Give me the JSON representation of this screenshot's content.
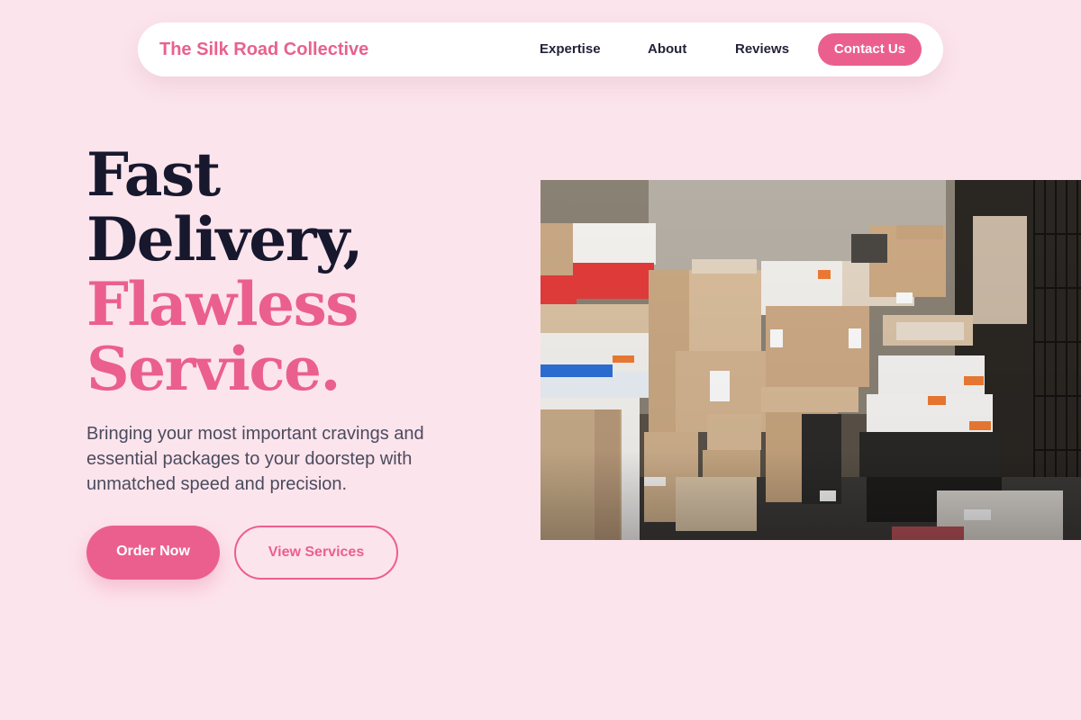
{
  "nav": {
    "brand": "The Silk Road Collective",
    "links": [
      {
        "label": "Expertise"
      },
      {
        "label": "About"
      },
      {
        "label": "Reviews"
      }
    ],
    "cta": "Contact Us"
  },
  "hero": {
    "headline": {
      "line1": "Fast",
      "line2": "Delivery,",
      "line3": "Flawless",
      "line4": "Service."
    },
    "subtitle": "Bringing your most important cravings and essential packages to your doorstep with unmatched speed and precision.",
    "primary_button": "Order Now",
    "secondary_button": "View Services"
  },
  "colors": {
    "accent": "#eb5f8f",
    "background": "#fce4ec",
    "heading_dark": "#17182e"
  }
}
